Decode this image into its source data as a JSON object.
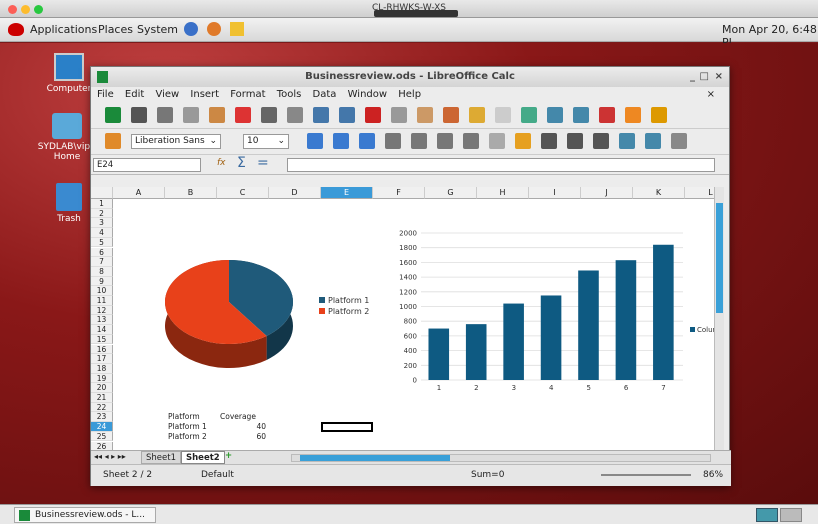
{
  "host": {
    "title": "CL-RHWKS-W-XS"
  },
  "topbar": {
    "applications": "Applications",
    "places": "Places",
    "system": "System",
    "clock": "Mon Apr 20,  6:48 PI"
  },
  "desktop": {
    "icons": [
      "Computer",
      "SYDLAB\\vipir Home",
      "Trash"
    ]
  },
  "taskbar": {
    "item": "Businessreview.ods - L..."
  },
  "window": {
    "title": "Businessreview.ods - LibreOffice Calc",
    "menu": [
      "File",
      "Edit",
      "View",
      "Insert",
      "Format",
      "Tools",
      "Data",
      "Window",
      "Help"
    ],
    "font_name": "Liberation Sans",
    "font_size": "10",
    "cell_ref": "E24",
    "formula": "",
    "columns": [
      "A",
      "B",
      "C",
      "D",
      "E",
      "F",
      "G",
      "H",
      "I",
      "J",
      "K",
      "L"
    ],
    "rows": [
      "1",
      "2",
      "3",
      "4",
      "5",
      "6",
      "7",
      "8",
      "9",
      "10",
      "11",
      "12",
      "13",
      "14",
      "15",
      "16",
      "17",
      "18",
      "19",
      "20",
      "21",
      "22",
      "23",
      "24",
      "25",
      "26"
    ],
    "table": {
      "header": [
        "Platform",
        "Coverage"
      ],
      "rows": [
        [
          "Platform 1",
          "40"
        ],
        [
          "Platform 2",
          "60"
        ]
      ]
    },
    "sheets": [
      "Sheet1",
      "Sheet2"
    ],
    "status": {
      "sheet": "Sheet 2 / 2",
      "style": "Default",
      "sum": "Sum=0",
      "zoom": "86%"
    }
  },
  "chart_data": [
    {
      "type": "pie",
      "categories": [
        "Platform 1",
        "Platform 2"
      ],
      "values": [
        40,
        60
      ],
      "legend": "right",
      "colors": [
        "#1f5a7a",
        "#e8411a"
      ]
    },
    {
      "type": "bar",
      "categories": [
        "1",
        "2",
        "3",
        "4",
        "5",
        "6",
        "7"
      ],
      "values": [
        700,
        760,
        1040,
        1150,
        1490,
        1630,
        1840
      ],
      "ylim": [
        0,
        2000
      ],
      "yticks": [
        "0",
        "200",
        "400",
        "600",
        "800",
        "1000",
        "1200",
        "1400",
        "1600",
        "1800",
        "2000"
      ],
      "legend_label": "Colum",
      "legend": "right",
      "grid": true,
      "color": "#0e5a82"
    }
  ]
}
